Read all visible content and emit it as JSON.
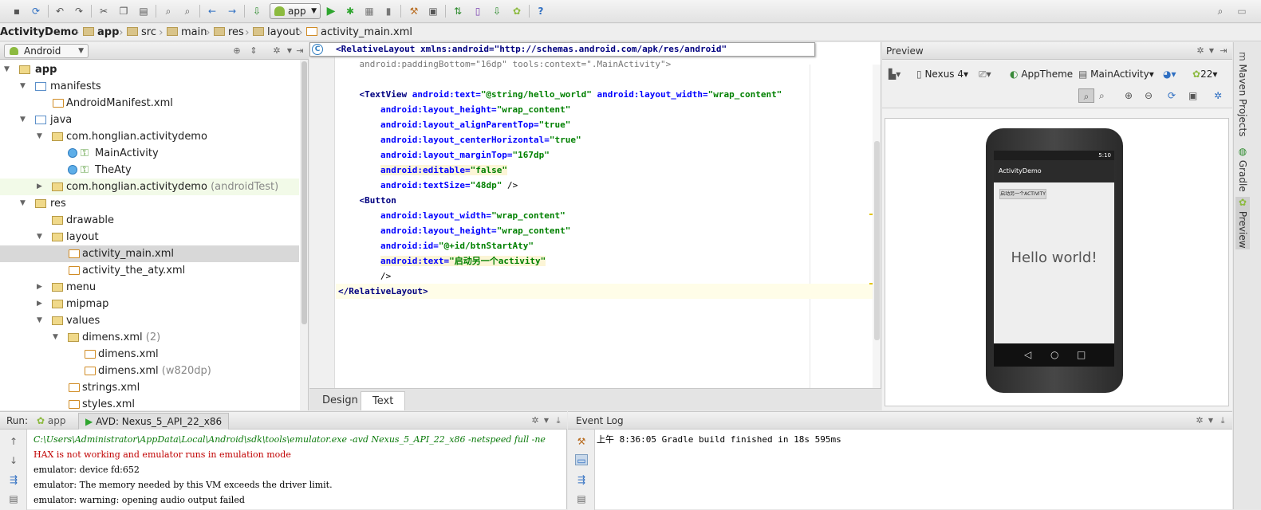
{
  "toolbar": {
    "run_config": "app"
  },
  "breadcrumbs": [
    "ActivityDemo",
    "app",
    "src",
    "main",
    "res",
    "layout",
    "activity_main.xml"
  ],
  "project": {
    "view_mode": "Android",
    "tree": [
      {
        "label": "app",
        "bold": true
      },
      {
        "label": "manifests"
      },
      {
        "label": "AndroidManifest.xml"
      },
      {
        "label": "java"
      },
      {
        "label": "com.honglian.activitydemo"
      },
      {
        "label": "MainActivity"
      },
      {
        "label": "TheAty"
      },
      {
        "label": "com.honglian.activitydemo",
        "suffix": "(androidTest)"
      },
      {
        "label": "res"
      },
      {
        "label": "drawable"
      },
      {
        "label": "layout"
      },
      {
        "label": "activity_main.xml"
      },
      {
        "label": "activity_the_aty.xml"
      },
      {
        "label": "menu"
      },
      {
        "label": "mipmap"
      },
      {
        "label": "values"
      },
      {
        "label": "dimens.xml",
        "suffix": "(2)"
      },
      {
        "label": "dimens.xml"
      },
      {
        "label": "dimens.xml",
        "suffix": "(w820dp)"
      },
      {
        "label": "strings.xml"
      },
      {
        "label": "styles.xml"
      }
    ]
  },
  "editor": {
    "tooltip": "<RelativeLayout xmlns:android=\"http://schemas.android.com/apk/res/android\"",
    "lines": [
      "    android:paddingBottom=\"16dp\" tools:context=\".MainActivity\">",
      "",
      "    <TextView android:text=\"@string/hello_world\" android:layout_width=\"wrap_content\"",
      "        android:layout_height=\"wrap_content\"",
      "        android:layout_alignParentTop=\"true\"",
      "        android:layout_centerHorizontal=\"true\"",
      "        android:layout_marginTop=\"167dp\"",
      "        android:editable=\"false\"",
      "        android:textSize=\"48dp\" />",
      "    <Button",
      "        android:layout_width=\"wrap_content\"",
      "        android:layout_height=\"wrap_content\"",
      "        android:id=\"@+id/btnStartAty\"",
      "        android:text=\"启动另一个activity\"",
      "        />",
      "</RelativeLayout>"
    ],
    "tabs": [
      "Design",
      "Text"
    ]
  },
  "preview": {
    "title": "Preview",
    "device": "Nexus 4",
    "theme": "AppTheme",
    "activity": "MainActivity",
    "api": "22",
    "phone": {
      "time": "5:10",
      "app_title": "ActivityDemo",
      "button_text": "启动另一个ACTIVITY",
      "hello_text": "Hello world!"
    }
  },
  "side_tabs": [
    "Maven Projects",
    "Gradle",
    "Preview"
  ],
  "run": {
    "label": "Run:",
    "tabs": [
      "app",
      "AVD: Nexus_5_API_22_x86"
    ],
    "lines": [
      "C:\\Users\\Administrator\\AppData\\Local\\Android\\sdk\\tools\\emulator.exe -avd Nexus_5_API_22_x86 -netspeed full -ne",
      "HAX is not working and emulator runs in emulation mode",
      "emulator: device fd:652",
      "emulator: The memory needed by this VM exceeds the driver limit.",
      "emulator: warning: opening audio output failed"
    ]
  },
  "event_log": {
    "title": "Event Log",
    "entries": [
      "上午 8:36:05 Gradle build finished in 18s 595ms"
    ]
  },
  "colors": {
    "tag": "#000080",
    "attr": "#0000ff",
    "value": "#008000",
    "run_path": "#0b7a0b",
    "error": "#c00000"
  }
}
